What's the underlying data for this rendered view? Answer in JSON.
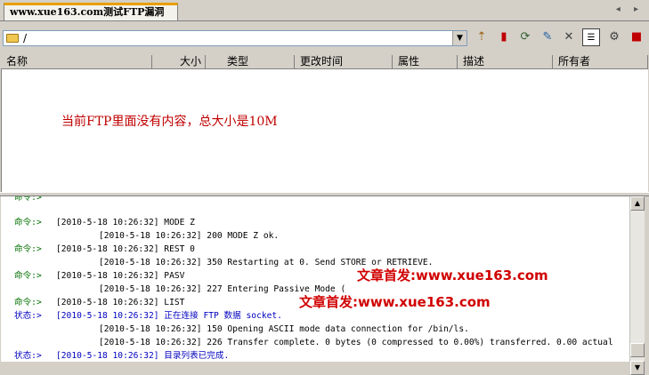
{
  "tab": {
    "title": "www.xue163.com测试FTP漏洞"
  },
  "tab_arrows": "◂ ▸",
  "path": {
    "value": "/"
  },
  "toolbar_icons": [
    "up-folder-icon",
    "bookmark-icon",
    "refresh-icon",
    "edit-icon",
    "delete-icon",
    "view-icon",
    "properties-icon",
    "stop-icon"
  ],
  "columns": [
    "名称",
    "大小",
    "类型",
    "更改时间",
    "属性",
    "描述",
    "所有者"
  ],
  "annotation_file_list": "当前FTP里面没有内容，总大小是10M",
  "log": [
    {
      "label": "命令:>",
      "text": "[2010-5-18 10:26:32] MODE Z",
      "kind": "cmd"
    },
    {
      "label": "",
      "text": "[2010-5-18 10:26:32] 200 MODE Z ok.",
      "kind": "resp"
    },
    {
      "label": "命令:>",
      "text": "[2010-5-18 10:26:32] REST 0",
      "kind": "cmd"
    },
    {
      "label": "",
      "text": "[2010-5-18 10:26:32] 350 Restarting at 0. Send STORE or RETRIEVE.",
      "kind": "resp"
    },
    {
      "label": "命令:>",
      "text": "[2010-5-18 10:26:32] PASV",
      "kind": "cmd"
    },
    {
      "label": "",
      "text": "[2010-5-18 10:26:32] 227 Entering Passive Mode (",
      "kind": "resp"
    },
    {
      "label": "命令:>",
      "text": "[2010-5-18 10:26:32] LIST",
      "kind": "cmd"
    },
    {
      "label": "状态:>",
      "text": "[2010-5-18 10:26:32] 正在连接 FTP 数据 socket.",
      "kind": "status"
    },
    {
      "label": "",
      "text": "[2010-5-18 10:26:32] 150 Opening ASCII mode data connection for /bin/ls.",
      "kind": "resp"
    },
    {
      "label": "",
      "text": "[2010-5-18 10:26:32] 226 Transfer complete. 0 bytes (0 compressed to 0.00%) transferred. 0.00 actual",
      "kind": "resp"
    },
    {
      "label": "状态:>",
      "text": "[2010-5-18 10:26:32] 目录列表已完成.",
      "kind": "status"
    }
  ],
  "watermark1": "文章首发:www.xue163.com",
  "watermark2": "文章首发:www.xue163.com",
  "colors": {
    "command": "#007000",
    "status": "#0000c0",
    "annotation": "#c00000"
  }
}
